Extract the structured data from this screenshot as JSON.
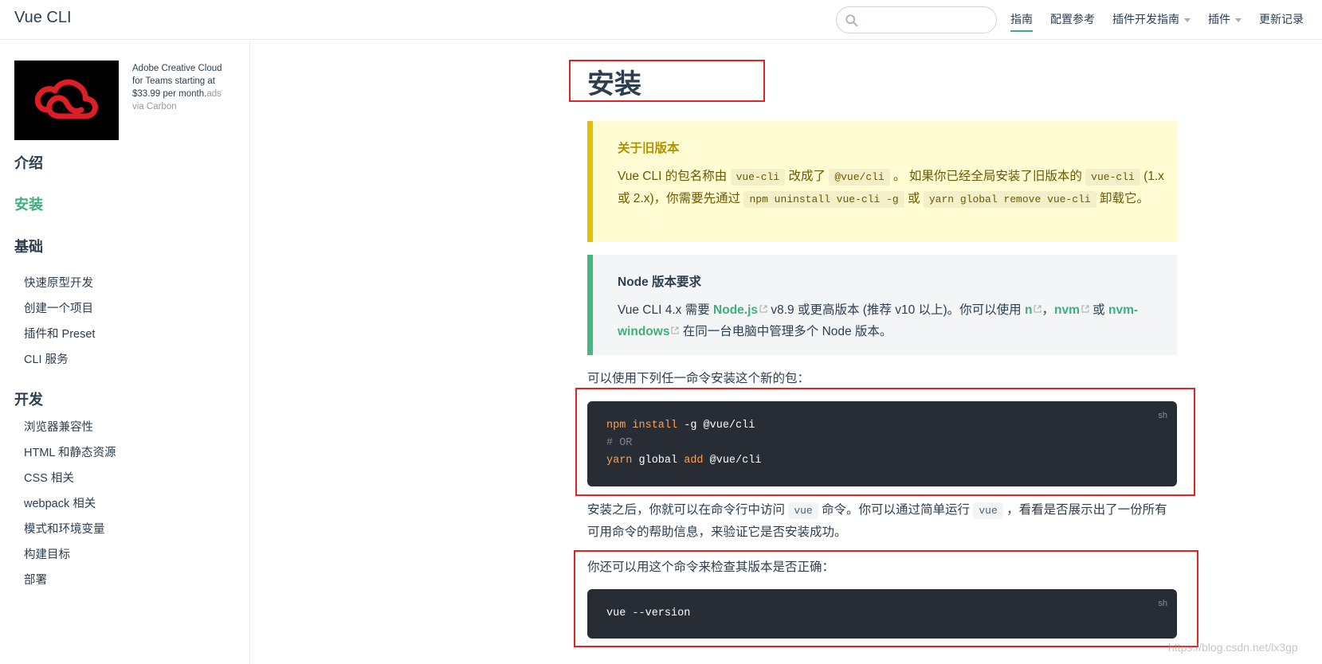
{
  "header": {
    "site_name": "Vue CLI",
    "search_placeholder": "",
    "nav": [
      {
        "label": "指南",
        "active": true,
        "dropdown": false
      },
      {
        "label": "配置参考",
        "active": false,
        "dropdown": false
      },
      {
        "label": "插件开发指南",
        "active": false,
        "dropdown": true
      },
      {
        "label": "插件",
        "active": false,
        "dropdown": true
      },
      {
        "label": "更新记录",
        "active": false,
        "dropdown": false
      }
    ]
  },
  "ad": {
    "text": "Adobe Creative Cloud for Teams starting at $33.99 per month.",
    "suffix": "ads via Carbon"
  },
  "sidebar": {
    "groups": [
      {
        "label": "介绍"
      },
      {
        "label": "安装"
      },
      {
        "label": "基础"
      },
      {
        "label": "开发"
      }
    ],
    "basics": [
      "快速原型开发",
      "创建一个项目",
      "插件和 Preset",
      "CLI 服务"
    ],
    "dev": [
      "浏览器兼容性",
      "HTML 和静态资源",
      "CSS 相关",
      "webpack 相关",
      "模式和环境变量",
      "构建目标",
      "部署"
    ]
  },
  "main": {
    "title": "安装",
    "warning": {
      "title": "关于旧版本",
      "t1": "Vue CLI 的包名称由",
      "c1": "vue-cli",
      "t2": "改成了",
      "c2": "@vue/cli",
      "t3": "。 如果你已经全局安装了旧版本的",
      "c3": "vue-cli",
      "t4": "(1.x 或 2.x)，你需要先通过",
      "c4": "npm uninstall vue-cli -g",
      "t5": "或",
      "c5": "yarn global remove vue-cli",
      "t6": "卸载它。"
    },
    "note": {
      "title": "Node 版本要求",
      "t1": "Vue CLI 4.x 需要",
      "l1": "Node.js",
      "t2": "v8.9 或更高版本 (推荐 v10 以上)。你可以使用",
      "l2": "n",
      "t3": "，",
      "l3": "nvm",
      "t4": "或",
      "l4": "nvm-windows",
      "t5": "在同一台电脑中管理多个 Node 版本。"
    },
    "install_intro": "可以使用下列任一命令安装这个新的包：",
    "code1": {
      "lang": "sh",
      "line1_cmd": "npm install",
      "line1_rest": " -g @vue/cli",
      "line2": "# OR",
      "line3_cmd1": "yarn",
      "line3_mid": " global ",
      "line3_cmd2": "add",
      "line3_rest": " @vue/cli"
    },
    "after": {
      "t1": "安装之后，你就可以在命令行中访问",
      "c1": "vue",
      "t2": "命令。你可以通过简单运行",
      "c2": "vue",
      "t3": "，看看是否展示出了一份所有可用命令的帮助信息，来验证它是否安装成功。"
    },
    "version_intro": "你还可以用这个命令来检查其版本是否正确：",
    "code2": {
      "lang": "sh",
      "line1": "vue --version"
    }
  },
  "watermark": "https://blog.csdn.net/lx3gp",
  "colors": {
    "accent": "#3eaf7c",
    "highlight_frame": "#e02424",
    "warning_bg": "#fffbd2",
    "warning_border": "#e6c000",
    "code_bg": "#282c34"
  }
}
